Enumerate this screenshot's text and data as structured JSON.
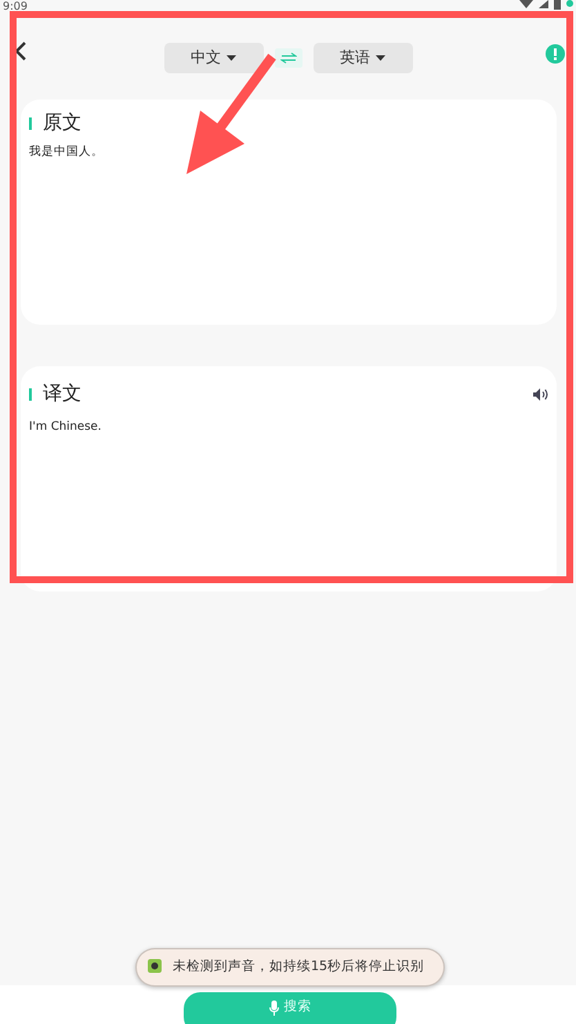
{
  "status_bar": {
    "time": "9:09"
  },
  "header": {
    "source_language": "中文",
    "target_language": "英语"
  },
  "panels": [
    {
      "title": "原文",
      "text": "我是中国人。",
      "speaker": false
    },
    {
      "title": "译文",
      "text": "I'm Chinese.",
      "speaker": true
    }
  ],
  "toast": {
    "text": "未检测到声音，如持续15秒后将停止识别"
  },
  "action_button": {
    "label": "搜索"
  }
}
